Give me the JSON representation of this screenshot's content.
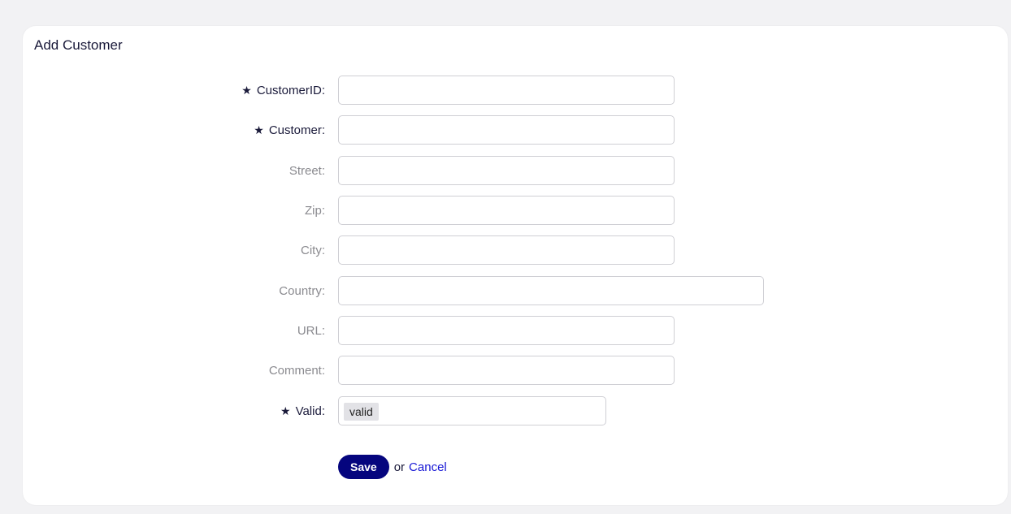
{
  "form": {
    "title": "Add Customer",
    "required_marker": "★",
    "fields": {
      "customer_id": {
        "label": "CustomerID:",
        "value": ""
      },
      "customer": {
        "label": "Customer:",
        "value": ""
      },
      "street": {
        "label": "Street:",
        "value": ""
      },
      "zip": {
        "label": "Zip:",
        "value": ""
      },
      "city": {
        "label": "City:",
        "value": ""
      },
      "country": {
        "label": "Country:",
        "value": ""
      },
      "url": {
        "label": "URL:",
        "value": ""
      },
      "comment": {
        "label": "Comment:",
        "value": ""
      },
      "valid": {
        "label": "Valid:",
        "selected": "valid"
      }
    },
    "actions": {
      "save_label": "Save",
      "or_text": "or",
      "cancel_label": "Cancel"
    }
  },
  "colors": {
    "accent": "#05057e",
    "link": "#1919d6",
    "background": "#f2f2f4"
  }
}
